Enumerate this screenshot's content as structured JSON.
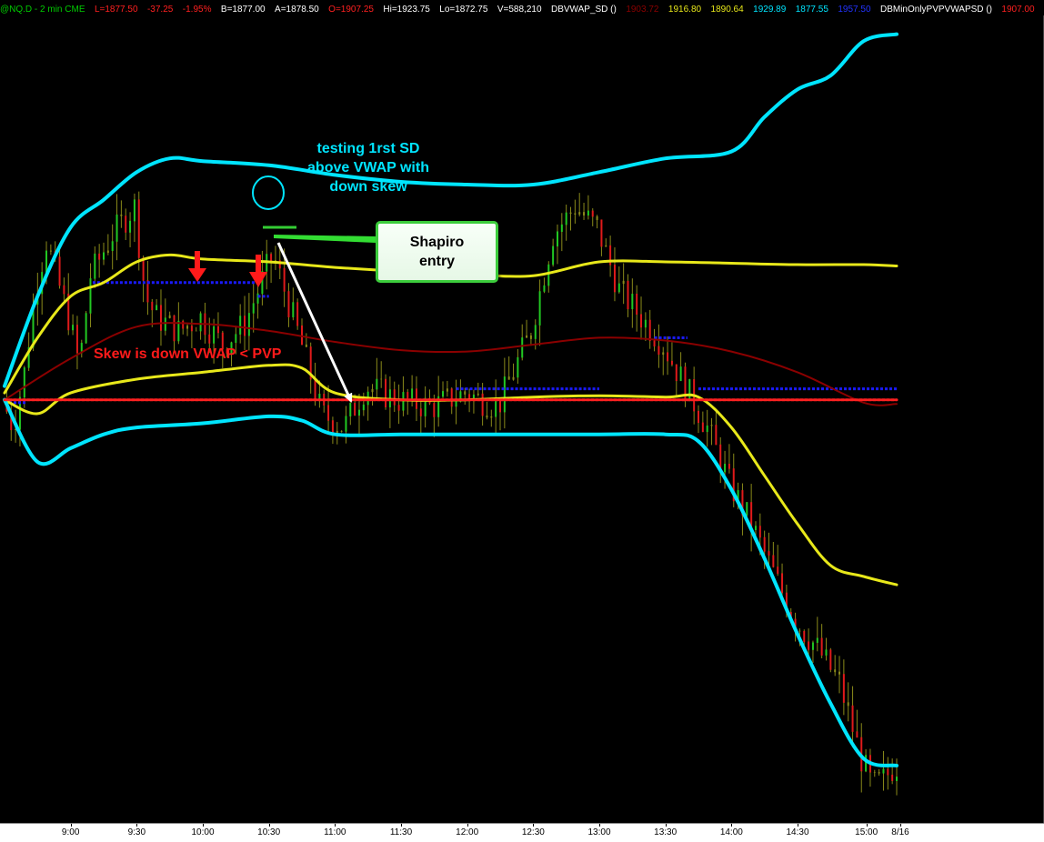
{
  "header": {
    "symbol": "@NQ.D - 2 min  CME",
    "last": "L=1877.50",
    "change": "-37.25",
    "change_pct": "-1.95%",
    "bid": "B=1877.00",
    "ask": "A=1878.50",
    "open": "O=1907.25",
    "high": "Hi=1923.75",
    "low": "Lo=1872.75",
    "volume": "V=588,210",
    "study1_name": "DBVWAP_SD ()",
    "study1_values": [
      "1903.72",
      "1916.80",
      "1890.64",
      "1929.89",
      "1877.55",
      "1957.50"
    ],
    "study2_name": "DBMinOnlyPVPVWAPSD ()",
    "study2_value": "1907.00"
  },
  "colors": {
    "background": "#000000",
    "sd2_band": "#00e5ff",
    "sd1_band": "#e8e81a",
    "vwap": "#8b0000",
    "pvp": "#ff2020",
    "blue_levels": "#1a1aff",
    "up_bar": "#22c822",
    "down_bar": "#e01a1a",
    "neutral_bar": "#8a8a1a",
    "callout_border": "#3ccc3c",
    "arrow_white": "#ffffff"
  },
  "annotations": {
    "testing_sd": "testing 1rst SD\nabove VWAP with\ndown skew",
    "shapiro_entry": "Shapiro\nentry",
    "skew": "Skew is down VWAP < PVP"
  },
  "chart_data": {
    "type": "line",
    "title": "",
    "xlabel": "",
    "ylabel": "",
    "x_ticks": [
      "9:00",
      "9:30",
      "10:00",
      "10:30",
      "11:00",
      "11:30",
      "12:00",
      "12:30",
      "13:00",
      "13:30",
      "14:00",
      "14:30",
      "15:00",
      "8/16"
    ],
    "x_range": [
      "8:30",
      "15:15"
    ],
    "y_range": [
      1872.75,
      1923.75
    ],
    "series": [
      {
        "role": "upper 2nd SD band",
        "x": [
          "8:30",
          "8:45",
          "9:00",
          "9:15",
          "9:30",
          "9:45",
          "10:00",
          "10:30",
          "11:00",
          "11:30",
          "12:00",
          "12:30",
          "13:00",
          "13:30",
          "14:00",
          "14:15",
          "14:30",
          "14:45",
          "15:00",
          "15:15"
        ],
        "y": [
          1905.0,
          1911.5,
          1916.5,
          1918.5,
          1920.5,
          1921.5,
          1921.3,
          1921.0,
          1920.3,
          1919.8,
          1919.6,
          1919.6,
          1920.5,
          1921.5,
          1922.0,
          1924.5,
          1926.5,
          1927.5,
          1930.0,
          1930.5
        ]
      },
      {
        "role": "upper 1st SD band",
        "x": [
          "8:30",
          "8:45",
          "9:00",
          "9:15",
          "9:30",
          "9:45",
          "10:00",
          "10:30",
          "11:00",
          "11:30",
          "12:00",
          "12:30",
          "13:00",
          "13:30",
          "14:00",
          "14:30",
          "15:00",
          "15:15"
        ],
        "y": [
          1904.5,
          1908.5,
          1911.5,
          1912.5,
          1914.0,
          1914.5,
          1914.2,
          1914.0,
          1913.6,
          1913.3,
          1913.1,
          1913.0,
          1914.0,
          1914.0,
          1913.9,
          1913.8,
          1913.8,
          1913.7
        ]
      },
      {
        "role": "VWAP",
        "x": [
          "8:30",
          "9:00",
          "9:30",
          "10:00",
          "10:30",
          "11:00",
          "11:30",
          "12:00",
          "12:30",
          "13:00",
          "13:30",
          "14:00",
          "14:30",
          "15:00",
          "15:15"
        ],
        "y": [
          1904.0,
          1907.0,
          1909.3,
          1909.5,
          1909.0,
          1908.2,
          1907.6,
          1907.5,
          1908.0,
          1908.5,
          1908.3,
          1907.5,
          1906.0,
          1903.8,
          1903.7
        ]
      },
      {
        "role": "lower 1st SD band",
        "x": [
          "8:30",
          "8:45",
          "9:00",
          "9:30",
          "10:00",
          "10:30",
          "10:45",
          "11:00",
          "11:30",
          "12:00",
          "12:30",
          "13:00",
          "13:30",
          "13:45",
          "14:00",
          "14:15",
          "14:30",
          "14:45",
          "15:00",
          "15:15"
        ],
        "y": [
          1904.0,
          1903.0,
          1904.5,
          1905.5,
          1906.0,
          1906.5,
          1906.3,
          1904.5,
          1904.0,
          1904.0,
          1904.2,
          1904.3,
          1904.2,
          1904.2,
          1902.0,
          1898.5,
          1895.0,
          1892.0,
          1891.2,
          1890.6
        ]
      },
      {
        "role": "lower 2nd SD band",
        "x": [
          "8:30",
          "8:45",
          "9:00",
          "9:15",
          "9:30",
          "10:00",
          "10:30",
          "10:45",
          "11:00",
          "11:30",
          "12:00",
          "12:30",
          "13:00",
          "13:30",
          "13:45",
          "14:00",
          "14:15",
          "14:30",
          "14:45",
          "15:00",
          "15:15"
        ],
        "y": [
          1904.0,
          1899.5,
          1900.5,
          1901.5,
          1902.0,
          1902.3,
          1902.8,
          1902.5,
          1901.5,
          1901.5,
          1901.5,
          1901.5,
          1901.5,
          1901.5,
          1901.0,
          1897.5,
          1892.5,
          1887.0,
          1882.0,
          1878.0,
          1877.5
        ]
      },
      {
        "role": "PVP",
        "x": [
          "8:30",
          "15:15"
        ],
        "y": [
          1904.0,
          1904.0
        ]
      }
    ],
    "levels": [
      {
        "role": "blue level",
        "x": [
          "9:10",
          "10:25"
        ],
        "y": 1912.5
      },
      {
        "role": "blue level",
        "x": [
          "10:25",
          "10:30"
        ],
        "y": 1911.5
      },
      {
        "role": "blue level",
        "x": [
          "11:55",
          "13:00"
        ],
        "y": 1904.8
      },
      {
        "role": "blue level",
        "x": [
          "13:25",
          "13:40"
        ],
        "y": 1908.5
      },
      {
        "role": "blue level",
        "x": [
          "13:45",
          "15:15"
        ],
        "y": 1904.8
      },
      {
        "role": "blue level",
        "x": [
          "8:30",
          "8:40"
        ],
        "y": 1903.8
      }
    ],
    "price_path": {
      "x": [
        "8:30",
        "8:35",
        "8:40",
        "8:45",
        "8:50",
        "9:00",
        "9:05",
        "9:10",
        "9:20",
        "9:30",
        "9:35",
        "9:40",
        "9:50",
        "10:00",
        "10:10",
        "10:20",
        "10:30",
        "10:33",
        "10:38",
        "10:45",
        "10:55",
        "11:05",
        "11:15",
        "11:30",
        "11:45",
        "12:00",
        "12:15",
        "12:30",
        "12:40",
        "12:50",
        "13:00",
        "13:10",
        "13:20",
        "13:30",
        "13:40",
        "13:50",
        "14:00",
        "14:10",
        "14:20",
        "14:30",
        "14:40",
        "14:50",
        "15:00",
        "15:05",
        "15:10",
        "15:15"
      ],
      "y": [
        1904.0,
        1902.0,
        1906.0,
        1912.0,
        1915.5,
        1910.0,
        1906.5,
        1913.0,
        1916.0,
        1918.0,
        1911.5,
        1910.0,
        1909.0,
        1910.0,
        1908.0,
        1909.5,
        1913.5,
        1914.5,
        1912.0,
        1908.5,
        1903.0,
        1902.0,
        1905.0,
        1904.0,
        1903.5,
        1904.5,
        1903.5,
        1909.0,
        1916.0,
        1918.0,
        1916.5,
        1912.0,
        1910.0,
        1908.0,
        1905.0,
        1902.0,
        1898.0,
        1895.0,
        1891.5,
        1888.0,
        1886.0,
        1883.5,
        1878.0,
        1876.0,
        1876.5,
        1877.5
      ]
    },
    "grid": false,
    "legend": "none"
  }
}
